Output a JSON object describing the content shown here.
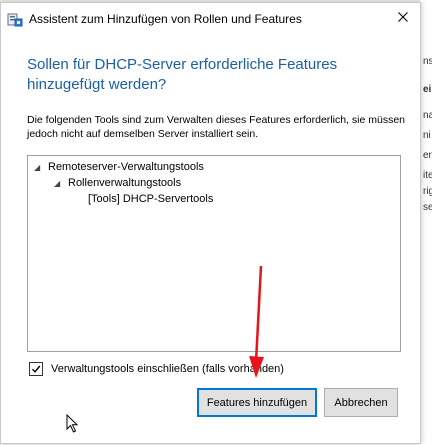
{
  "background": {
    "right_texts": [
      "ns",
      "eil",
      "na",
      "ni",
      "er",
      "ite",
      "rig",
      "ser"
    ]
  },
  "dialog": {
    "title": "Assistent zum Hinzufügen von Rollen und Features",
    "heading": "Sollen für DHCP-Server erforderliche Features hinzugefügt werden?",
    "description": "Die folgenden Tools sind zum Verwalten dieses Features erforderlich, sie müssen jedoch nicht auf demselben Server installiert sein.",
    "tree": [
      {
        "label": "Remoteserver-Verwaltungstools",
        "level": 0,
        "expanded": true
      },
      {
        "label": "Rollenverwaltungstools",
        "level": 1,
        "expanded": true
      },
      {
        "label": "[Tools] DHCP-Servertools",
        "level": 2,
        "expanded": false
      }
    ],
    "include_tools_checkbox": {
      "label": "Verwaltungstools einschließen (falls vorhanden)",
      "checked": true
    },
    "buttons": {
      "add": "Features hinzufügen",
      "cancel": "Abbrechen"
    }
  },
  "colors": {
    "heading": "#1a5fa8",
    "annotation_arrow": "#e8141b",
    "primary_button_border": "#0078d7"
  },
  "icons": {
    "app": "server-manager-icon",
    "close": "close-icon",
    "tree_expand": "triangle-expanded-icon",
    "cursor": "mouse-pointer-icon"
  }
}
